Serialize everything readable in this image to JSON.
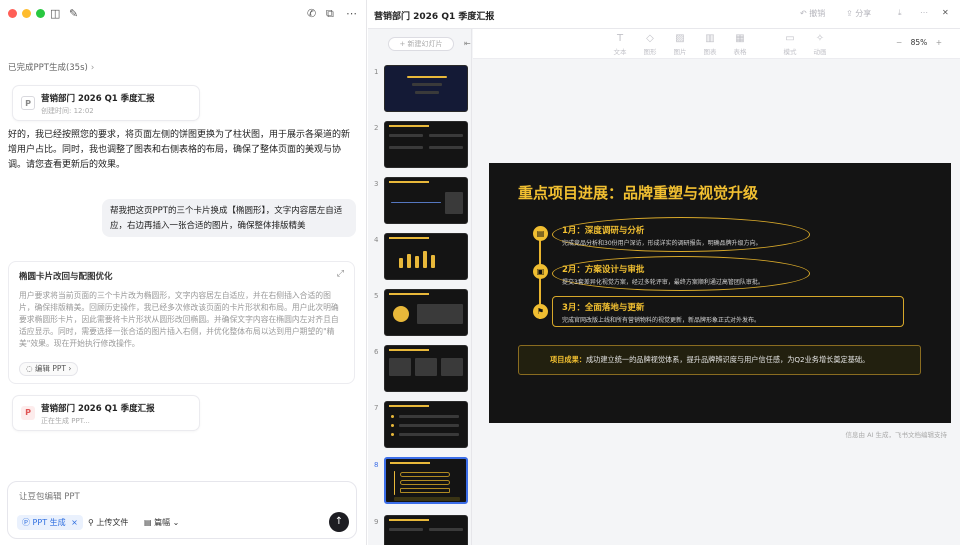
{
  "window": {
    "title_icons": [
      "sidebar-toggle-icon",
      "new-chat-icon"
    ],
    "traffic_colors": [
      "#ff5f57",
      "#febc2e",
      "#28c840"
    ]
  },
  "chat": {
    "status": "已完成PPT生成(35s)",
    "file_card_1": {
      "title": "营销部门 2026 Q1 季度汇报",
      "sub": "创建时间: 12:02"
    },
    "ai_message": "好的，我已经按照您的要求，将页面左侧的饼图更换为了柱状图，用于展示各渠道的新增用户占比。同时，我也调整了图表和右侧表格的布局，确保了整体页面的美观与协调。请您查看更新后的效果。",
    "user_message": "帮我把这页PPT的三个卡片换成【椭圆形】，文字内容居左自适应，右边再插入一张合适的图片，确保整体排版精美",
    "thinking": {
      "title": "椭圆卡片改回与配图优化",
      "body": "用户要求将当前页面的三个卡片改为椭圆形，文字内容居左自适应，并在右侧插入合适的图片，确保排版精美。回顾历史操作，我已经多次修改该页面的卡片形状和布局。用户此次明确要求椭圆形卡片，因此需要将卡片形状从圆形改回椭圆。并确保文字内容在椭圆内左对齐且自适应显示。同时，需要选择一张合适的图片插入右侧，并优化整体布局以达到用户期望的\"精美\"效果。现在开始执行修改操作。",
      "edit_chip": "编辑 PPT"
    },
    "file_card_2": {
      "title": "营销部门 2026 Q1 季度汇报",
      "sub": "正在生成 PPT..."
    },
    "input": {
      "placeholder": "让豆包编辑 PPT",
      "chip_ppt": "PPT 生成",
      "upload": "上传文件",
      "length": "篇幅"
    }
  },
  "editor": {
    "doc_title": "营销部门 2026 Q1 季度汇报",
    "header_actions": [
      "撤销",
      "分享"
    ],
    "new_slide": "+ 新建幻灯片",
    "toolbar": [
      "文本",
      "图形",
      "图片",
      "图表",
      "表格",
      "模式",
      "动画"
    ],
    "zoom": "85%",
    "slide_numbers": [
      "1",
      "2",
      "3",
      "4",
      "5",
      "6",
      "7",
      "8",
      "9"
    ],
    "active_slide": 8,
    "footer_note": "信息由 AI 生成，飞书文档编辑支持"
  },
  "slide": {
    "title": "重点项目进展：品牌重塑与视觉升级",
    "items": [
      {
        "icon": "document-icon",
        "heading": "1月：深度调研与分析",
        "text": "完成竞品分析和30份用户深访，形成详实的调研报告，明确品牌升级方向。"
      },
      {
        "icon": "briefcase-icon",
        "heading": "2月：方案设计与审批",
        "text": "提交3套差异化视觉方案，经过多轮评审，最终方案顺利通过高管团队审批。"
      },
      {
        "icon": "flag-icon",
        "heading": "3月：全面落地与更新",
        "text": "完成官网改版上线和所有营销物料的视觉更新，新品牌形象正式对外发布。"
      }
    ],
    "result_label": "项目成果：",
    "result_text": "成功建立统一的品牌视觉体系，提升品牌辨识度与用户信任感，为Q2业务增长奠定基础。",
    "accent": "#f2c031",
    "background": "#141414"
  }
}
